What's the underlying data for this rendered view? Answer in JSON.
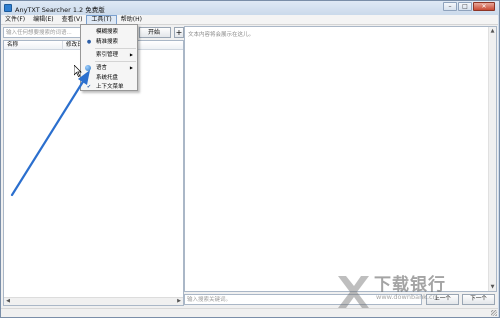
{
  "window": {
    "title": "AnyTXT Searcher 1.2 免费版"
  },
  "titlebar_buttons": {
    "minimize": "–",
    "maximize": "□",
    "close": "✕"
  },
  "menubar": {
    "items": [
      {
        "label": "文件(F)"
      },
      {
        "label": "编辑(E)"
      },
      {
        "label": "查看(V)"
      },
      {
        "label": "工具(T)"
      },
      {
        "label": "帮助(H)"
      }
    ]
  },
  "search": {
    "placeholder": "输入任何想要搜索的词语...",
    "start_label": "开始",
    "add_label": "+"
  },
  "file_list": {
    "columns": [
      "名称",
      "修改日"
    ]
  },
  "scroll_arrows": {
    "left": "◀",
    "right": "▶",
    "up": "▲",
    "down": "▼"
  },
  "preview": {
    "placeholder": "文本内容将会展示在这儿。"
  },
  "keyword": {
    "placeholder": "输入搜索关键词。",
    "prev_label": "上一个",
    "next_label": "下一个"
  },
  "tools_menu": {
    "items": [
      {
        "label": "模糊搜索",
        "mark": ""
      },
      {
        "label": "精准搜索",
        "mark": "●"
      },
      {
        "label": "索引管理",
        "mark": "",
        "submenu": "▶"
      },
      {
        "label": "语言",
        "mark": "globe",
        "submenu": "▶"
      },
      {
        "label": "系统托盘",
        "mark": ""
      },
      {
        "label": "上下文菜单",
        "mark": "✔"
      }
    ]
  },
  "watermark": {
    "text": "下载银行",
    "url": "www.downbank.cn"
  },
  "colors": {
    "arrow": "#2b6fce",
    "titlebar": "#cfdcec",
    "menu_highlight": "#dfe9f5"
  }
}
